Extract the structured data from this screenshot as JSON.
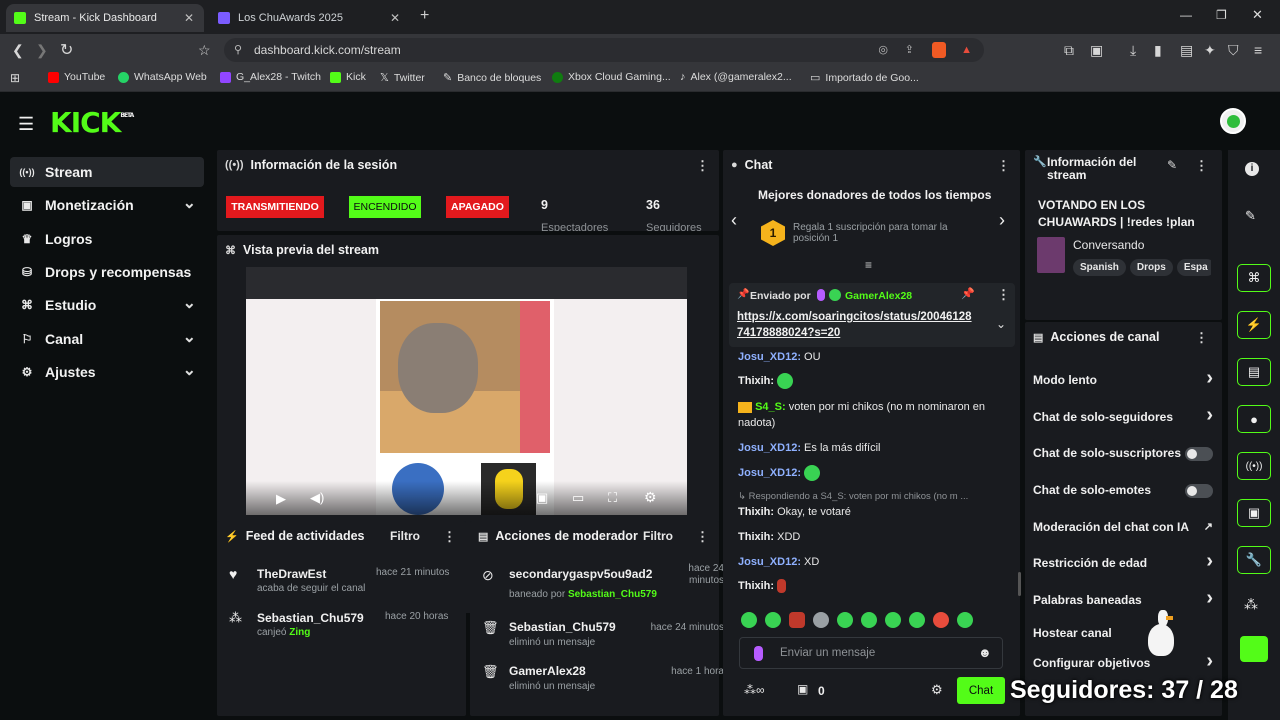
{
  "browser": {
    "tabs": [
      {
        "title": "Stream - Kick Dashboard",
        "active": true
      },
      {
        "title": "Los ChuAwards 2025",
        "active": false
      }
    ],
    "url": "dashboard.kick.com/stream",
    "bookmarks": [
      "YouTube",
      "WhatsApp Web",
      "G_Alex28 - Twitch",
      "Kick",
      "Twitter",
      "Banco de bloques",
      "Xbox Cloud Gaming...",
      "Alex (@gameralex2...",
      "Importado de Goo..."
    ]
  },
  "header": {
    "logo": "KICK",
    "logo_tag": "BETA"
  },
  "sidebar": {
    "items": [
      {
        "label": "Stream",
        "icon": "broadcast-icon",
        "active": true
      },
      {
        "label": "Monetización",
        "icon": "money-icon",
        "chevron": true
      },
      {
        "label": "Logros",
        "icon": "trophy-icon"
      },
      {
        "label": "Drops y recompensas",
        "icon": "drops-icon"
      },
      {
        "label": "Estudio",
        "icon": "studio-icon",
        "chevron": true
      },
      {
        "label": "Canal",
        "icon": "channel-icon",
        "chevron": true
      },
      {
        "label": "Ajustes",
        "icon": "gear-icon",
        "chevron": true
      }
    ]
  },
  "session": {
    "title": "Información de la sesión",
    "badges": [
      {
        "label": "TRANSMITIENDO",
        "color": "#e3191d"
      },
      {
        "label": "ENCENDIDO",
        "color": "#53fc18"
      },
      {
        "label": "APAGADO",
        "color": "#e3191d"
      }
    ],
    "viewers": "9",
    "viewers_label": "Espectadores",
    "followers": "36",
    "followers_label": "Seguidores"
  },
  "preview": {
    "title": "Vista previa del stream"
  },
  "feed": {
    "title": "Feed de actividades",
    "filter": "Filtro",
    "items": [
      {
        "name": "TheDrawEst",
        "sub": "acaba de seguir el canal",
        "time": "hace 21 minutos"
      },
      {
        "name": "Sebastian_Chu579",
        "sub": "canjeó",
        "sub_highlight": "Zing",
        "time": "hace 20 horas"
      }
    ]
  },
  "modactions": {
    "title": "Acciones de moderador",
    "filter": "Filtro",
    "items": [
      {
        "name": "secondarygaspv5ou9ad2",
        "sub": "baneado por",
        "sub_highlight": "Sebastian_Chu579",
        "time": "hace 24 minutos"
      },
      {
        "name": "Sebastian_Chu579",
        "sub": "eliminó un mensaje",
        "time": "hace 24 minutos"
      },
      {
        "name": "GamerAlex28",
        "sub": "eliminó un mensaje",
        "time": "hace 1 hora"
      }
    ]
  },
  "chat": {
    "title": "Chat",
    "donors_title": "Mejores donadores de todos los tiempos",
    "donor_rank": "1",
    "donor_text": "Regala 1 suscripción para tomar la posición 1",
    "pinned_label": "Enviado por",
    "pinned_user": "GamerAlex28",
    "pinned_link": "https://x.com/soaringcitos/status/2004612874178888024?s=20",
    "messages": [
      {
        "user": "Josu_XD12",
        "text": "OU",
        "color": "blue"
      },
      {
        "user": "Thixih",
        "text": "",
        "emote": true,
        "color": "white"
      },
      {
        "user": "S4_S",
        "text": "voten por mi chikos (no m nominaron en nadota)",
        "color": "green"
      },
      {
        "user": "Josu_XD12",
        "text": "Es la más difícil",
        "color": "blue"
      },
      {
        "user": "Josu_XD12",
        "text": "",
        "emote": true,
        "color": "blue"
      },
      {
        "reply": "Respondiendo a S4_S: voten por mi chikos (no m ..."
      },
      {
        "user": "Thixih",
        "text": "Okay, te votaré",
        "color": "white"
      },
      {
        "user": "Thixih",
        "text": "XDD",
        "color": "white"
      },
      {
        "user": "Josu_XD12",
        "text": "XD",
        "color": "blue"
      },
      {
        "user": "Thixih",
        "text": "",
        "emote": true,
        "color": "white"
      }
    ],
    "input_placeholder": "Enviar un mensaje",
    "points": "0",
    "send_label": "Chat"
  },
  "streaminfo": {
    "title": "Información del stream",
    "stream_title": "VOTANDO EN LOS CHUAWARDS | !redes !plan",
    "category": "Conversando",
    "tags": [
      "Spanish",
      "Drops",
      "Espa"
    ]
  },
  "channel_actions": {
    "title": "Acciones de canal",
    "rows": [
      {
        "label": "Modo lento",
        "type": "arrow"
      },
      {
        "label": "Chat de solo-seguidores",
        "type": "arrow"
      },
      {
        "label": "Chat de solo-suscriptores",
        "type": "toggle"
      },
      {
        "label": "Chat de solo-emotes",
        "type": "toggle"
      },
      {
        "label": "Moderación del chat con IA",
        "type": "external"
      },
      {
        "label": "Restricción de edad",
        "type": "arrow"
      },
      {
        "label": "Palabras baneadas",
        "type": "arrow"
      },
      {
        "label": "Hostear canal",
        "type": "none"
      },
      {
        "label": "Configurar objetivos",
        "type": "arrow"
      }
    ]
  },
  "overlay": {
    "followers_text": "Seguidores: 37 / 28"
  },
  "colors": {
    "accent": "#53fc18",
    "live_red": "#e3191d",
    "panel": "#191b1f",
    "bg": "#0b0e0f"
  }
}
